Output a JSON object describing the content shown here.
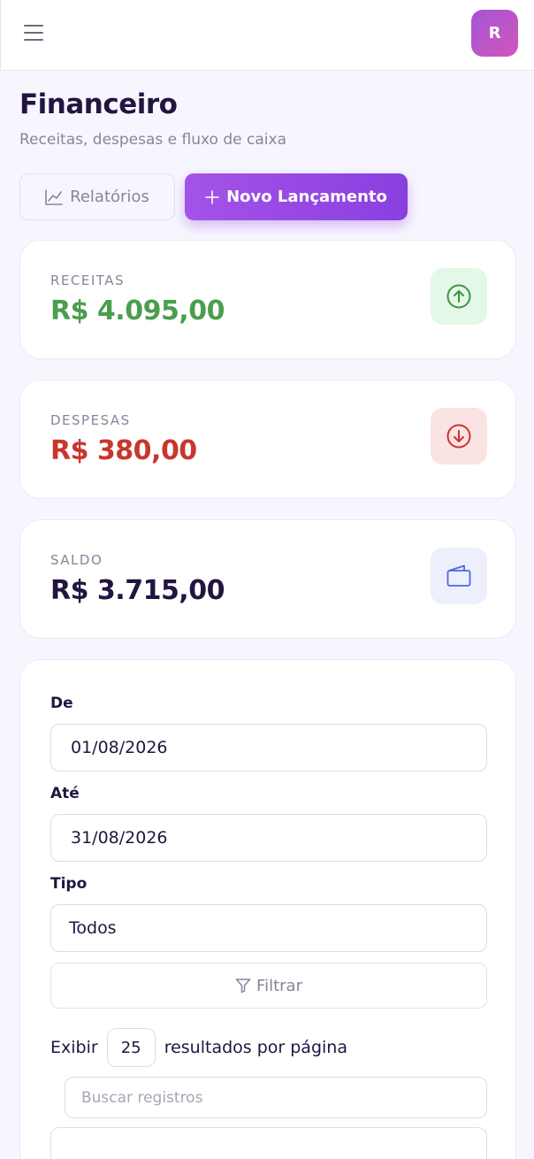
{
  "header": {
    "menu_icon": "hamburger-menu-icon",
    "avatar_initial": "R"
  },
  "page": {
    "title": "Financeiro",
    "subtitle": "Receitas, despesas e fluxo de caixa"
  },
  "actions": {
    "reports_label": "Relatórios",
    "reports_icon": "line-chart-icon",
    "new_label": "Novo Lançamento",
    "new_icon": "plus-icon"
  },
  "summary": {
    "income": {
      "label": "RECEITAS",
      "value": "R$ 4.095,00",
      "color": "#4a9e4e",
      "icon": "arrow-up-circle-icon"
    },
    "expenses": {
      "label": "DESPESAS",
      "value": "R$ 380,00",
      "color": "#c9362d",
      "icon": "arrow-down-circle-icon"
    },
    "balance": {
      "label": "SALDO",
      "value": "R$ 3.715,00",
      "color": "#221540",
      "icon": "wallet-icon"
    }
  },
  "filters": {
    "from_label": "De",
    "from_value": "01/08/2026",
    "to_label": "Até",
    "to_value": "31/08/2026",
    "type_label": "Tipo",
    "type_value": "Todos",
    "filter_button": "Filtrar",
    "filter_icon": "funnel-icon"
  },
  "table_controls": {
    "show_label": "Exibir",
    "per_page": "25",
    "per_page_suffix": "resultados por página",
    "search_placeholder": "Buscar registros"
  },
  "colors": {
    "accent": "#9a4be6",
    "income_bg": "#e3f8e6",
    "expense_bg": "#fae3e2",
    "balance_bg": "#edeffd"
  }
}
